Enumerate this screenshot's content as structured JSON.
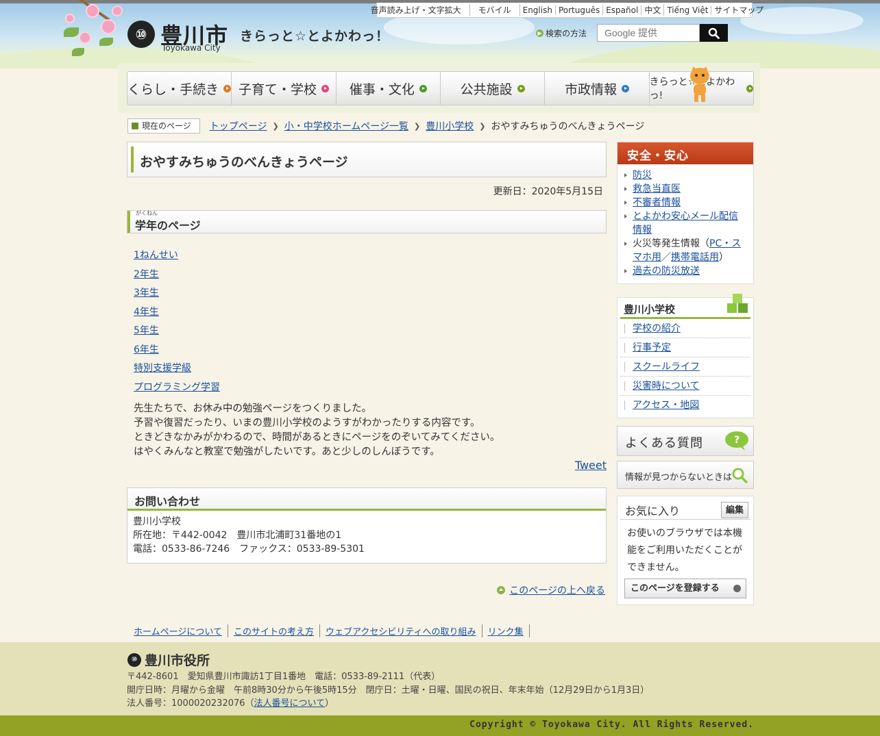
{
  "header": {
    "city_name": "豊川市",
    "city_name_en": "Toyokawa City",
    "tagline": "きらっと☆とよかわっ！",
    "util_nav": [
      "音声読み上げ・文字拡大",
      "モバイル",
      "English",
      "Português",
      "Español",
      "中文",
      "Tiếng Việt",
      "サイトマップ"
    ],
    "search_help": "検索の方法",
    "search_placeholder": "Google 提供",
    "colors": {
      "sky": "#9cc7e6",
      "accent_green": "#9ab53b"
    }
  },
  "global_nav": [
    {
      "label": "くらし・手続き",
      "dot_color": "#e07a1f"
    },
    {
      "label": "子育て・学校",
      "dot_color": "#e5457a"
    },
    {
      "label": "催事・文化",
      "dot_color": "#4e9a2a"
    },
    {
      "label": "公共施設",
      "dot_color": "#7c9b1e"
    },
    {
      "label": "市政情報",
      "dot_color": "#2f7fc1"
    },
    {
      "label": "きらっと☆とよかわっ!",
      "dot_color": "#7c9b1e"
    }
  ],
  "breadcrumb": {
    "here_label": "現在のページ",
    "items": [
      "トップページ",
      "小・中学校ホームページ一覧",
      "豊川小学校"
    ],
    "current": "おやすみちゅうのべんきょうページ"
  },
  "main": {
    "title": "おやすみちゅうのべんきょうページ",
    "updated": "更新日：2020年5月15日",
    "section_heading": "学年のページ",
    "section_ruby": "がくねん",
    "links": [
      "1ねんせい",
      "2年生",
      "3年生",
      "4年生",
      "5年生",
      "6年生",
      "特別支援学級",
      "プログラミング学習"
    ],
    "intro": [
      "先生たちで、お休み中の勉強ページをつくりました。",
      "予習や復習だったり、いまの豊川小学校のようすがわかったりする内容です。",
      "ときどきなかみがかわるので、時間があるときにページをのぞいてみてください。",
      "はやくみんなと教室で勉強がしたいです。あと少しのしんぼうです。"
    ],
    "tweet": "Tweet",
    "contact": {
      "heading": "お問い合わせ",
      "lines": [
        "豊川小学校",
        "所在地：〒442-0042　豊川市北浦町31番地の1",
        "電話：0533-86-7246　ファックス：0533-89-5301"
      ]
    },
    "page_top": "このページの上へ戻る"
  },
  "sidebar": {
    "safety": {
      "heading": "安全・安心",
      "items": [
        "防災",
        "救急当直医",
        "不審者情報",
        "とよかわ安心メール配信情報"
      ],
      "fire_prefix": "火災等発生情報（",
      "fire_link1": "PC・スマホ用",
      "fire_sep": "／",
      "fire_link2": "携帯電話用",
      "fire_suffix": "）",
      "last_item": "過去の防災放送"
    },
    "school": {
      "heading": "豊川小学校",
      "items": [
        "学校の紹介",
        "行事予定",
        "スクールライフ",
        "災害時について",
        "アクセス・地図"
      ]
    },
    "faq": "よくある質問",
    "not_found": "情報が見つからないときは",
    "favorites": {
      "heading": "お気に入り",
      "edit": "編集",
      "message": "お使いのブラウザでは本機能をご利用いただくことができません。",
      "register": "このページを登録する"
    }
  },
  "footer": {
    "links": [
      "ホームページについて",
      "このサイトの考え方",
      "ウェブアクセシビリティへの取り組み",
      "リンク集"
    ],
    "office": "豊川市役所",
    "address": "〒442-8601　愛知県豊川市諏訪1丁目1番地　電話：0533-89-2111（代表）",
    "hours": "開庁日時：月曜から金曜　午前8時30分から午後5時15分　閉庁日：土曜・日曜、国民の祝日、年末年始（12月29日から1月3日）",
    "corp_prefix": "法人番号：1000020232076（",
    "corp_link": "法人番号について",
    "corp_suffix": "）",
    "copyright": "Copyright © Toyokawa City. All Rights Reserved."
  }
}
